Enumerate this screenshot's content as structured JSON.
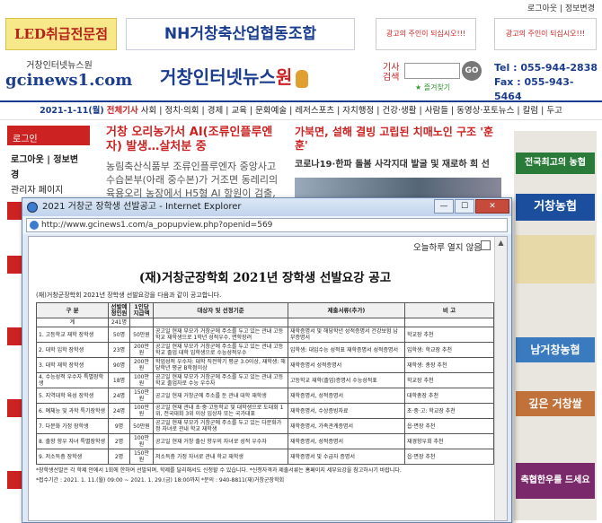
{
  "topbar": {
    "logout": "로그아웃",
    "divider": "|",
    "info_edit": "정보변경"
  },
  "ads": {
    "led": "LED취급전문점",
    "nh": "NH거창축산업협동조합",
    "slot1": "광고의 주인이 되십시오!!!",
    "slot2": "광고의 주인이 되십시오!!!"
  },
  "logo": {
    "small_line1": "거창인터넷뉴스원",
    "small_line2": "gcinews1.com",
    "big_main": "거창인터넷뉴스",
    "big_won": "원"
  },
  "search": {
    "label": "기사검색",
    "go": "GO",
    "favorite": "즐겨찾기"
  },
  "contact": {
    "tel": "Tel : 055-944-2838",
    "fax": "Fax : 055-943-5464"
  },
  "nav": {
    "date": "2021-1-11(월)",
    "highlight": "전체기사",
    "items": "사회 | 정치·의회 | 경제 | 교육 | 문화예술 | 레저스포츠 | 자치행정 | 건강·생활 | 사람들 | 동영상·포토뉴스 | 칼럼 | 두고"
  },
  "left": {
    "header": "로그인",
    "line1": "로그아웃 | 정보변",
    "line2": "경",
    "line3": "관리자 페이지"
  },
  "news": {
    "n1_title": "거창 오리농가서 AI(조류인플루엔자) 발생…살처분 중",
    "n1_body": "농림축산식품부 조류인플루엔자 중앙사고 수습본부(아래 중수본)가 거조면 동레리의 육용오리 농장에서 H5형 AI 항원이 검출, 반경",
    "n2_title": "가북면, 설해 결빙 고립된 치매노인 구조 '훈훈'",
    "n2_sub": "코로나19·한파 돌봄 사각지대 발굴 및 재로하 희 선"
  },
  "right": {
    "b1": "전국최고의 농협",
    "b2": "거창농협",
    "b3": "남거창농협",
    "b4": "깊은 거창쌀",
    "b5": "축협한우를 드세요"
  },
  "popup": {
    "window_title": "2021 거창군 장학생 선발공고 - Internet Explorer",
    "url": "http://www.gcinews1.com/a_popupview.php?openid=569",
    "hide_today": "오늘하루 열지 않음",
    "minimize": "—",
    "maximize": "☐",
    "close": "✕",
    "notice_title": "(재)거창군장학회 2021년 장학생 선발요강 공고",
    "intro": "(재)거창군장학회 2021년 장학생 선발요강을 다음과 같이 공고합니다.",
    "table": {
      "headers": [
        "구 분",
        "선발예정인원",
        "1인당 지급액",
        "대상자 및 선정기준",
        "제출서류(추가)",
        "비 고"
      ],
      "rows": [
        [
          "계",
          "241명",
          "",
          "",
          "",
          ""
        ],
        [
          "1. 고등학교 재학 장학생",
          "50명",
          "50만원",
          "공고일 현재 부모가 거창군에 주소를 두고 있는 관내 고등학교 재학생으로 1학년 성적우수, 면학장려",
          "재학증명서 및 해당학년 성적증명서 건강보험 납부증명서",
          "학교장 추천"
        ],
        [
          "2. 대학 입학 장학생",
          "23명",
          "200만원",
          "공고일 현재 부모가 거창군에 주소를 두고 있는 관내 고등학교 졸업 대학 입학생으로 수능성적우수",
          "입학생: 대입수능 성적표 재학증명서 성적증명서",
          "입학생: 학교장 추천"
        ],
        [
          "3. 대학 재학 장학생",
          "90명",
          "200만원",
          "학업성적 우수자: 대학 직전학기 평균 3.0이상, 재학생: 해당학년 평균 B학점이상",
          "재학증명서 성적증명서",
          "재학생: 총장 추천"
        ],
        [
          "4. 수능성적 우수자 특별장학생",
          "18명",
          "100만원",
          "공고일 현재 부모가 거창군에 주소를 두고 있는 관내 고등학교 졸업자로 수능 우수자",
          "고등학교 재학(졸업)증명서 수능성적표",
          "학교장 추천"
        ],
        [
          "5. 지역대학 육성 장학생",
          "24명",
          "150만원",
          "공고일 현재 거창군에 주소를 둔 관내 대학 재학생",
          "재학증명서, 성적증명서",
          "대학총장 추천"
        ],
        [
          "6. 예체능 및 과학 특기장학생",
          "24명",
          "100만원",
          "공고일 현재 관내 초·중·고등학교 및 대학생으로 도대회 1위, 전국대회 3위 이상 입상자 또는 국가대표",
          "재학증명서, 수상증빙자료",
          "초·중·고: 학교장 추천"
        ],
        [
          "7. 다문화 가정 장학생",
          "9명",
          "50만원",
          "공고일 현재 부모가 거창군에 주소를 두고 있는 다문화가정 자녀로 관내 학교 재학생",
          "재학증명서, 가족관계증명서",
          "읍·면장 추천"
        ],
        [
          "8. 출향 향우 자녀 특별장학생",
          "2명",
          "100만원",
          "공고일 현재 거창 출신 향우의 자녀로 성적 우수자",
          "재학증명서, 성적증명서",
          "재경향우회 추천"
        ],
        [
          "9. 저소득층 장학생",
          "2명",
          "150만원",
          "저소득층 가정 자녀로 관내 학교 재학생",
          "재학증명서 및 수급자 증명서",
          "읍·면장 추천"
        ]
      ]
    },
    "foot1": "*장학생선발은 각 학제 안에서 1회에 한하여 선발되며, 학제를 달리해서도 신청할 수 있습니다. *신청자격과 제출서류는 홈페이지 세부요강을 참고하시기 바랍니다.",
    "foot2": "*접수기간 : 2021. 1. 11.(월) 09:00 ~ 2021. 1. 29.(금) 18:00까지  *문의 : 940-8811(재)거창군장학회"
  }
}
